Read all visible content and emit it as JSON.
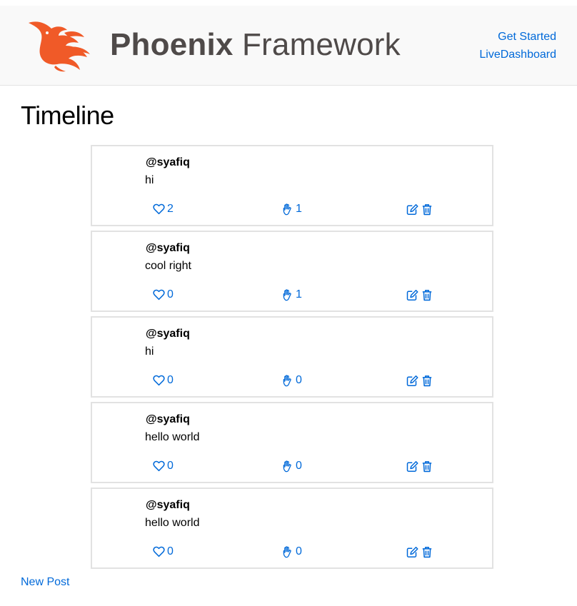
{
  "header": {
    "brand_bold": "Phoenix",
    "brand_light": "Framework",
    "nav": [
      {
        "label": "Get Started"
      },
      {
        "label": "LiveDashboard"
      }
    ]
  },
  "main": {
    "title": "Timeline",
    "new_post_label": "New Post"
  },
  "posts": [
    {
      "username": "@syafiq",
      "body": "hi",
      "likes": "2",
      "reposts": "1"
    },
    {
      "username": "@syafiq",
      "body": "cool right",
      "likes": "0",
      "reposts": "1"
    },
    {
      "username": "@syafiq",
      "body": "hi",
      "likes": "0",
      "reposts": "0"
    },
    {
      "username": "@syafiq",
      "body": "hello world",
      "likes": "0",
      "reposts": "0"
    },
    {
      "username": "@syafiq",
      "body": "hello world",
      "likes": "0",
      "reposts": "0"
    }
  ],
  "icons": {
    "logo": "phoenix-logo-icon",
    "like": "heart-icon",
    "repost": "hand-icon",
    "edit": "edit-icon",
    "delete": "trash-icon"
  },
  "colors": {
    "link": "#0069d9",
    "logo": "#f05a28",
    "brand_text": "#4f4a49",
    "header_bg": "#f9f9f9"
  }
}
